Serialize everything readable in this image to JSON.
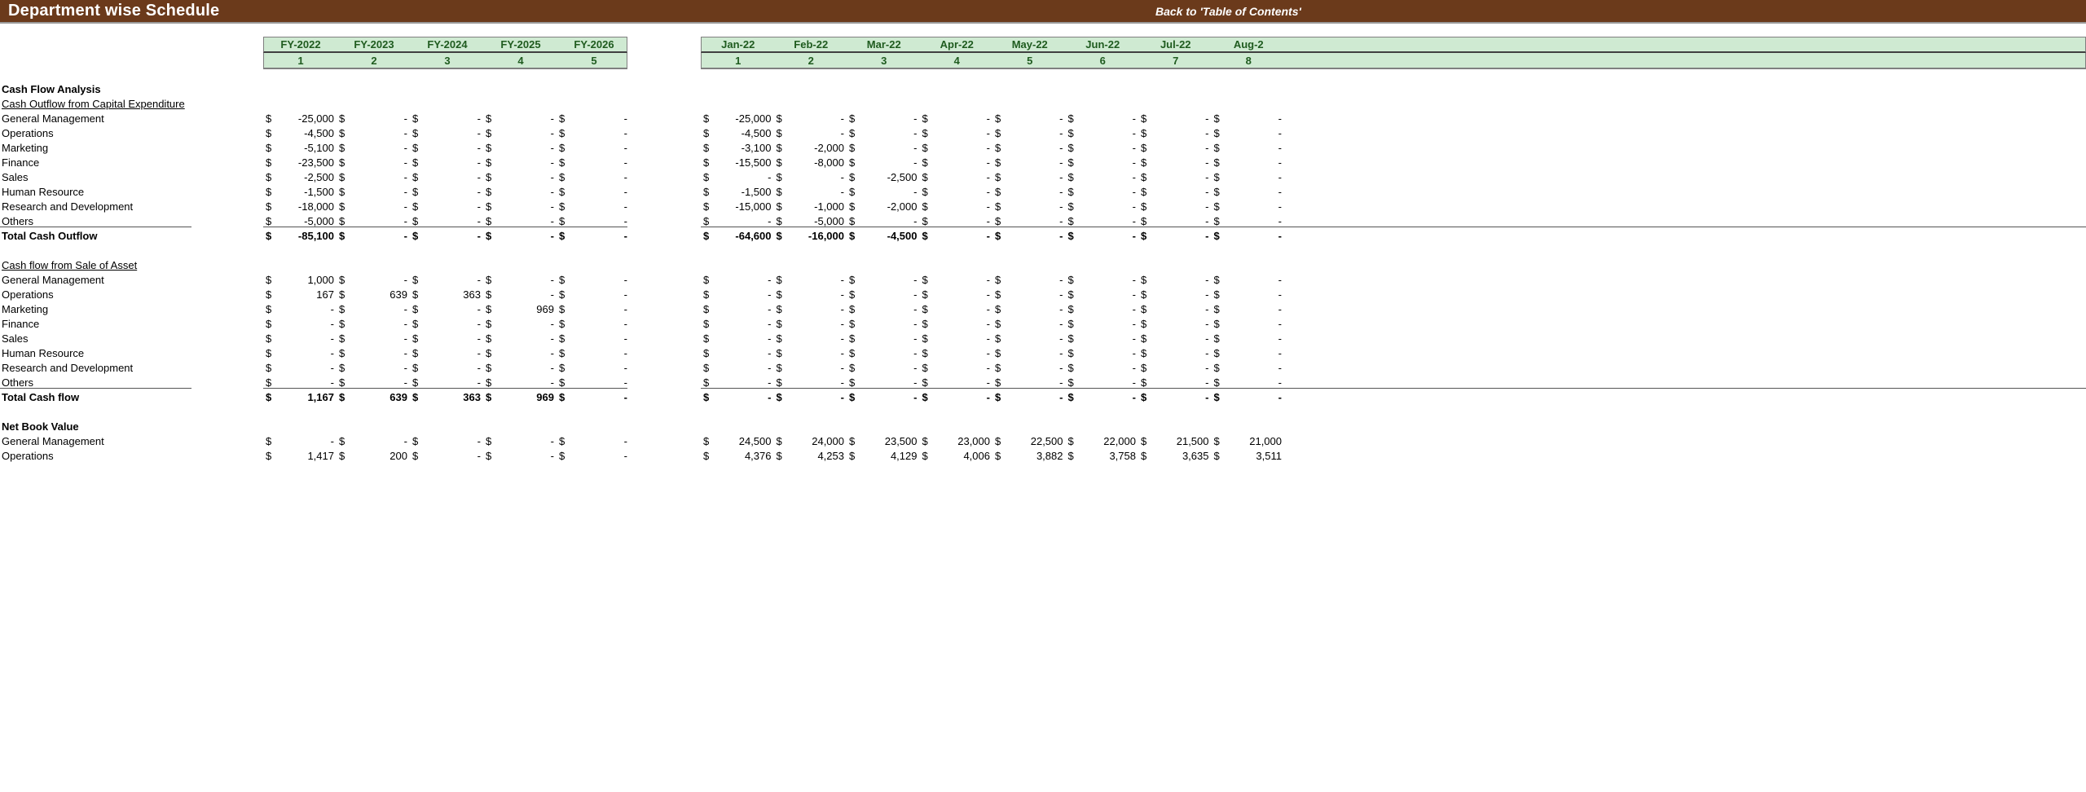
{
  "header": {
    "title": "Department wise Schedule",
    "toc_link": "Back to 'Table of Contents'",
    "bar_color": "#6B3A1B",
    "header_band_color": "#CFEAD2",
    "header_text_color": "#1F5B1F"
  },
  "fy_header": {
    "labels": [
      "FY-2022",
      "FY-2023",
      "FY-2024",
      "FY-2025",
      "FY-2026"
    ],
    "indices": [
      "1",
      "2",
      "3",
      "4",
      "5"
    ]
  },
  "month_header": {
    "labels": [
      "Jan-22",
      "Feb-22",
      "Mar-22",
      "Apr-22",
      "May-22",
      "Jun-22",
      "Jul-22",
      "Aug-2"
    ],
    "indices": [
      "1",
      "2",
      "3",
      "4",
      "5",
      "6",
      "7",
      "8"
    ]
  },
  "sections": [
    {
      "id": "cash-flow-analysis",
      "title": "Cash Flow Analysis",
      "subtitle": "Cash Outflow from Capital Expenditure",
      "rows": [
        {
          "label": "General Management",
          "fy": [
            "-25,000",
            "-",
            "-",
            "-",
            "-"
          ],
          "mo": [
            "-25,000",
            "-",
            "-",
            "-",
            "-",
            "-",
            "-",
            "-"
          ]
        },
        {
          "label": "Operations",
          "fy": [
            "-4,500",
            "-",
            "-",
            "-",
            "-"
          ],
          "mo": [
            "-4,500",
            "-",
            "-",
            "-",
            "-",
            "-",
            "-",
            "-"
          ]
        },
        {
          "label": "Marketing",
          "fy": [
            "-5,100",
            "-",
            "-",
            "-",
            "-"
          ],
          "mo": [
            "-3,100",
            "-2,000",
            "-",
            "-",
            "-",
            "-",
            "-",
            "-"
          ]
        },
        {
          "label": "Finance",
          "fy": [
            "-23,500",
            "-",
            "-",
            "-",
            "-"
          ],
          "mo": [
            "-15,500",
            "-8,000",
            "-",
            "-",
            "-",
            "-",
            "-",
            "-"
          ]
        },
        {
          "label": "Sales",
          "fy": [
            "-2,500",
            "-",
            "-",
            "-",
            "-"
          ],
          "mo": [
            "-",
            "-",
            "-2,500",
            "-",
            "-",
            "-",
            "-",
            "-"
          ]
        },
        {
          "label": "Human Resource",
          "fy": [
            "-1,500",
            "-",
            "-",
            "-",
            "-"
          ],
          "mo": [
            "-1,500",
            "-",
            "-",
            "-",
            "-",
            "-",
            "-",
            "-"
          ]
        },
        {
          "label": "Research and Development",
          "fy": [
            "-18,000",
            "-",
            "-",
            "-",
            "-"
          ],
          "mo": [
            "-15,000",
            "-1,000",
            "-2,000",
            "-",
            "-",
            "-",
            "-",
            "-"
          ]
        },
        {
          "label": "Others",
          "fy": [
            "-5,000",
            "-",
            "-",
            "-",
            "-"
          ],
          "mo": [
            "-",
            "-5,000",
            "-",
            "-",
            "-",
            "-",
            "-",
            "-"
          ]
        }
      ],
      "total": {
        "label": "Total Cash Outflow",
        "fy": [
          "-85,100",
          "-",
          "-",
          "-",
          "-"
        ],
        "mo": [
          "-64,600",
          "-16,000",
          "-4,500",
          "-",
          "-",
          "-",
          "-",
          "-"
        ]
      }
    },
    {
      "id": "cash-flow-sale-of-asset",
      "title": "",
      "subtitle": "Cash flow from Sale of Asset",
      "rows": [
        {
          "label": "General Management",
          "fy": [
            "1,000",
            "-",
            "-",
            "-",
            "-"
          ],
          "mo": [
            "-",
            "-",
            "-",
            "-",
            "-",
            "-",
            "-",
            "-"
          ]
        },
        {
          "label": "Operations",
          "fy": [
            "167",
            "639",
            "363",
            "-",
            "-"
          ],
          "mo": [
            "-",
            "-",
            "-",
            "-",
            "-",
            "-",
            "-",
            "-"
          ]
        },
        {
          "label": "Marketing",
          "fy": [
            "-",
            "-",
            "-",
            "969",
            "-"
          ],
          "mo": [
            "-",
            "-",
            "-",
            "-",
            "-",
            "-",
            "-",
            "-"
          ]
        },
        {
          "label": "Finance",
          "fy": [
            "-",
            "-",
            "-",
            "-",
            "-"
          ],
          "mo": [
            "-",
            "-",
            "-",
            "-",
            "-",
            "-",
            "-",
            "-"
          ]
        },
        {
          "label": "Sales",
          "fy": [
            "-",
            "-",
            "-",
            "-",
            "-"
          ],
          "mo": [
            "-",
            "-",
            "-",
            "-",
            "-",
            "-",
            "-",
            "-"
          ]
        },
        {
          "label": "Human Resource",
          "fy": [
            "-",
            "-",
            "-",
            "-",
            "-"
          ],
          "mo": [
            "-",
            "-",
            "-",
            "-",
            "-",
            "-",
            "-",
            "-"
          ]
        },
        {
          "label": "Research and Development",
          "fy": [
            "-",
            "-",
            "-",
            "-",
            "-"
          ],
          "mo": [
            "-",
            "-",
            "-",
            "-",
            "-",
            "-",
            "-",
            "-"
          ]
        },
        {
          "label": "Others",
          "fy": [
            "-",
            "-",
            "-",
            "-",
            "-"
          ],
          "mo": [
            "-",
            "-",
            "-",
            "-",
            "-",
            "-",
            "-",
            "-"
          ]
        }
      ],
      "total": {
        "label": "Total Cash flow",
        "fy": [
          "1,167",
          "639",
          "363",
          "969",
          "-"
        ],
        "mo": [
          "-",
          "-",
          "-",
          "-",
          "-",
          "-",
          "-",
          "-"
        ]
      }
    },
    {
      "id": "net-book-value",
      "title": "Net Book Value",
      "subtitle": "",
      "rows": [
        {
          "label": "General Management",
          "fy": [
            "-",
            "-",
            "-",
            "-",
            "-"
          ],
          "mo": [
            "24,500",
            "24,000",
            "23,500",
            "23,000",
            "22,500",
            "22,000",
            "21,500",
            "21,000"
          ]
        },
        {
          "label": "Operations",
          "fy": [
            "1,417",
            "200",
            "-",
            "-",
            "-"
          ],
          "mo": [
            "4,376",
            "4,253",
            "4,129",
            "4,006",
            "3,882",
            "3,758",
            "3,635",
            "3,511"
          ]
        }
      ],
      "total": null
    }
  ],
  "currency_symbol": "$"
}
